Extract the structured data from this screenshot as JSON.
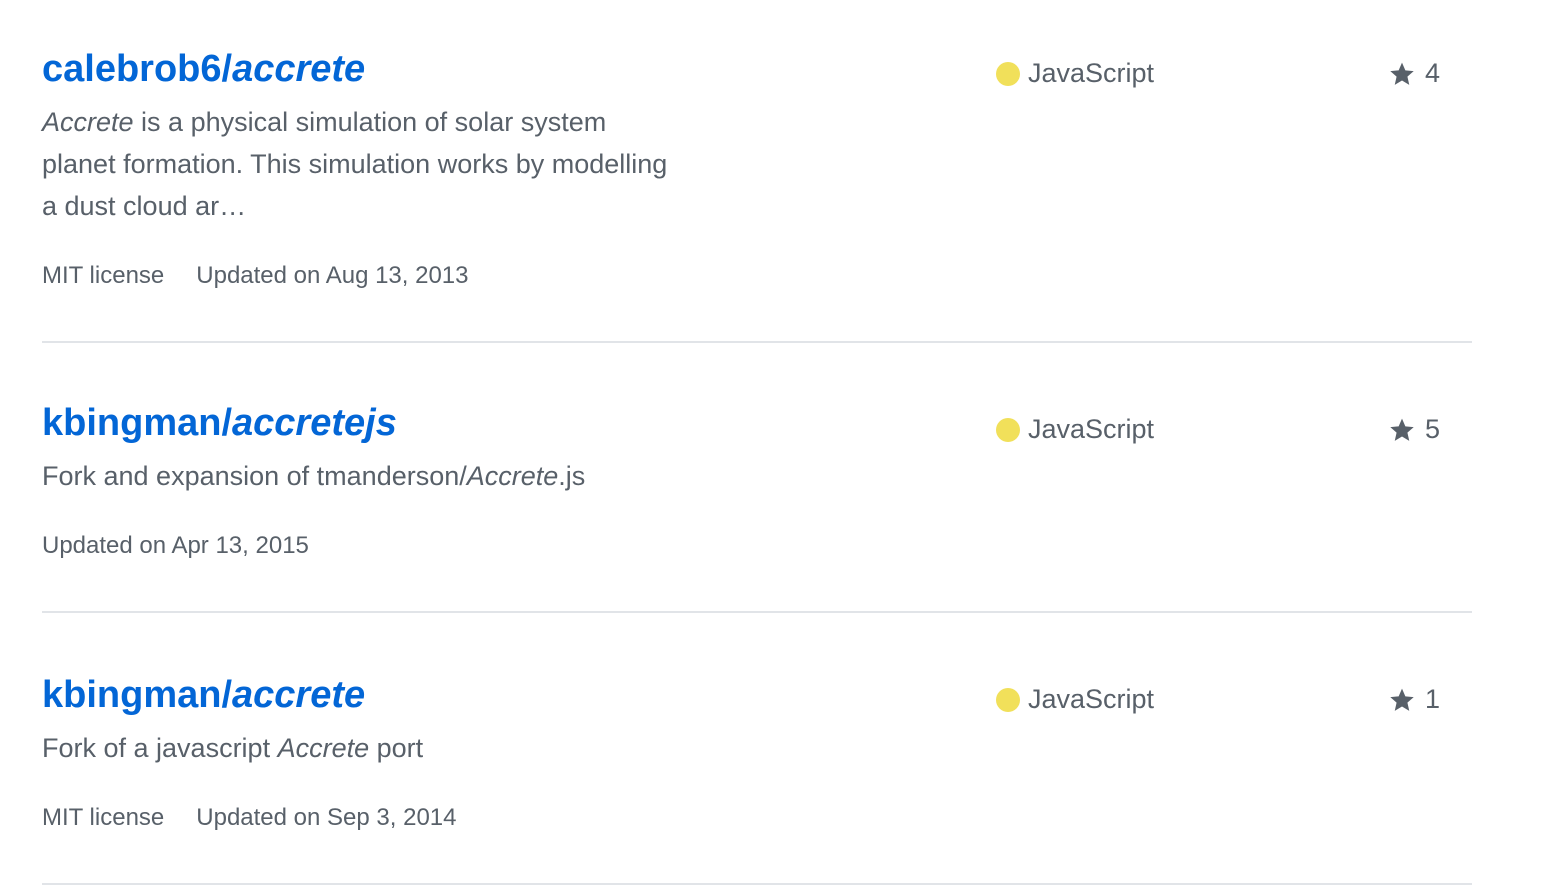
{
  "colors": {
    "link": "#0366d6",
    "muted": "#586069",
    "javascript_dot": "#f1e05a",
    "divider": "#e1e4e8"
  },
  "repos": [
    {
      "owner": "calebrob6/",
      "name": "accrete",
      "description_em": "Accrete",
      "description_rest": " is a physical simulation of solar system planet formation. This simulation works by modelling a dust cloud ar…",
      "license": "MIT license",
      "updated": "Updated on Aug 13, 2013",
      "language": "JavaScript",
      "stars": "4",
      "star_icon": "star-icon"
    },
    {
      "owner": "kbingman/",
      "name": "accretejs",
      "description_pre": "Fork and expansion of tmanderson/",
      "description_em": "Accrete",
      "description_post": ".js",
      "updated": "Updated on Apr 13, 2015",
      "language": "JavaScript",
      "stars": "5",
      "star_icon": "star-icon"
    },
    {
      "owner": "kbingman/",
      "name": "accrete",
      "description_pre": "Fork of a javascript ",
      "description_em": "Accrete",
      "description_post": " port",
      "license": "MIT license",
      "updated": "Updated on Sep 3, 2014",
      "language": "JavaScript",
      "stars": "1",
      "star_icon": "star-icon"
    }
  ]
}
